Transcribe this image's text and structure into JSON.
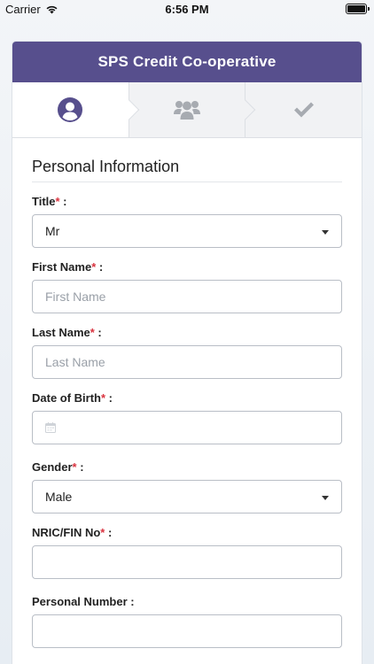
{
  "status_bar": {
    "carrier": "Carrier",
    "time": "6:56 PM"
  },
  "header": {
    "title": "SPS Credit Co-operative"
  },
  "steps": [
    {
      "icon": "user-icon",
      "active": true
    },
    {
      "icon": "users-icon",
      "active": false
    },
    {
      "icon": "check-icon",
      "active": false
    }
  ],
  "form": {
    "section_title": "Personal Information",
    "fields": {
      "title": {
        "label": "Title",
        "value": "Mr",
        "required": true
      },
      "first_name": {
        "label": "First Name",
        "placeholder": "First Name",
        "required": true
      },
      "last_name": {
        "label": "Last Name",
        "placeholder": "Last Name",
        "required": true
      },
      "dob": {
        "label": "Date of Birth",
        "required": true
      },
      "gender": {
        "label": "Gender",
        "value": "Male",
        "required": true
      },
      "nric": {
        "label": "NRIC/FIN No",
        "required": true
      },
      "personal_number": {
        "label": "Personal Number",
        "required": false
      }
    }
  },
  "colors": {
    "header_bg": "#574f8d",
    "required": "#d9333f",
    "active_step_icon": "#574f8d",
    "inactive_step_icon": "#a7abb1"
  }
}
